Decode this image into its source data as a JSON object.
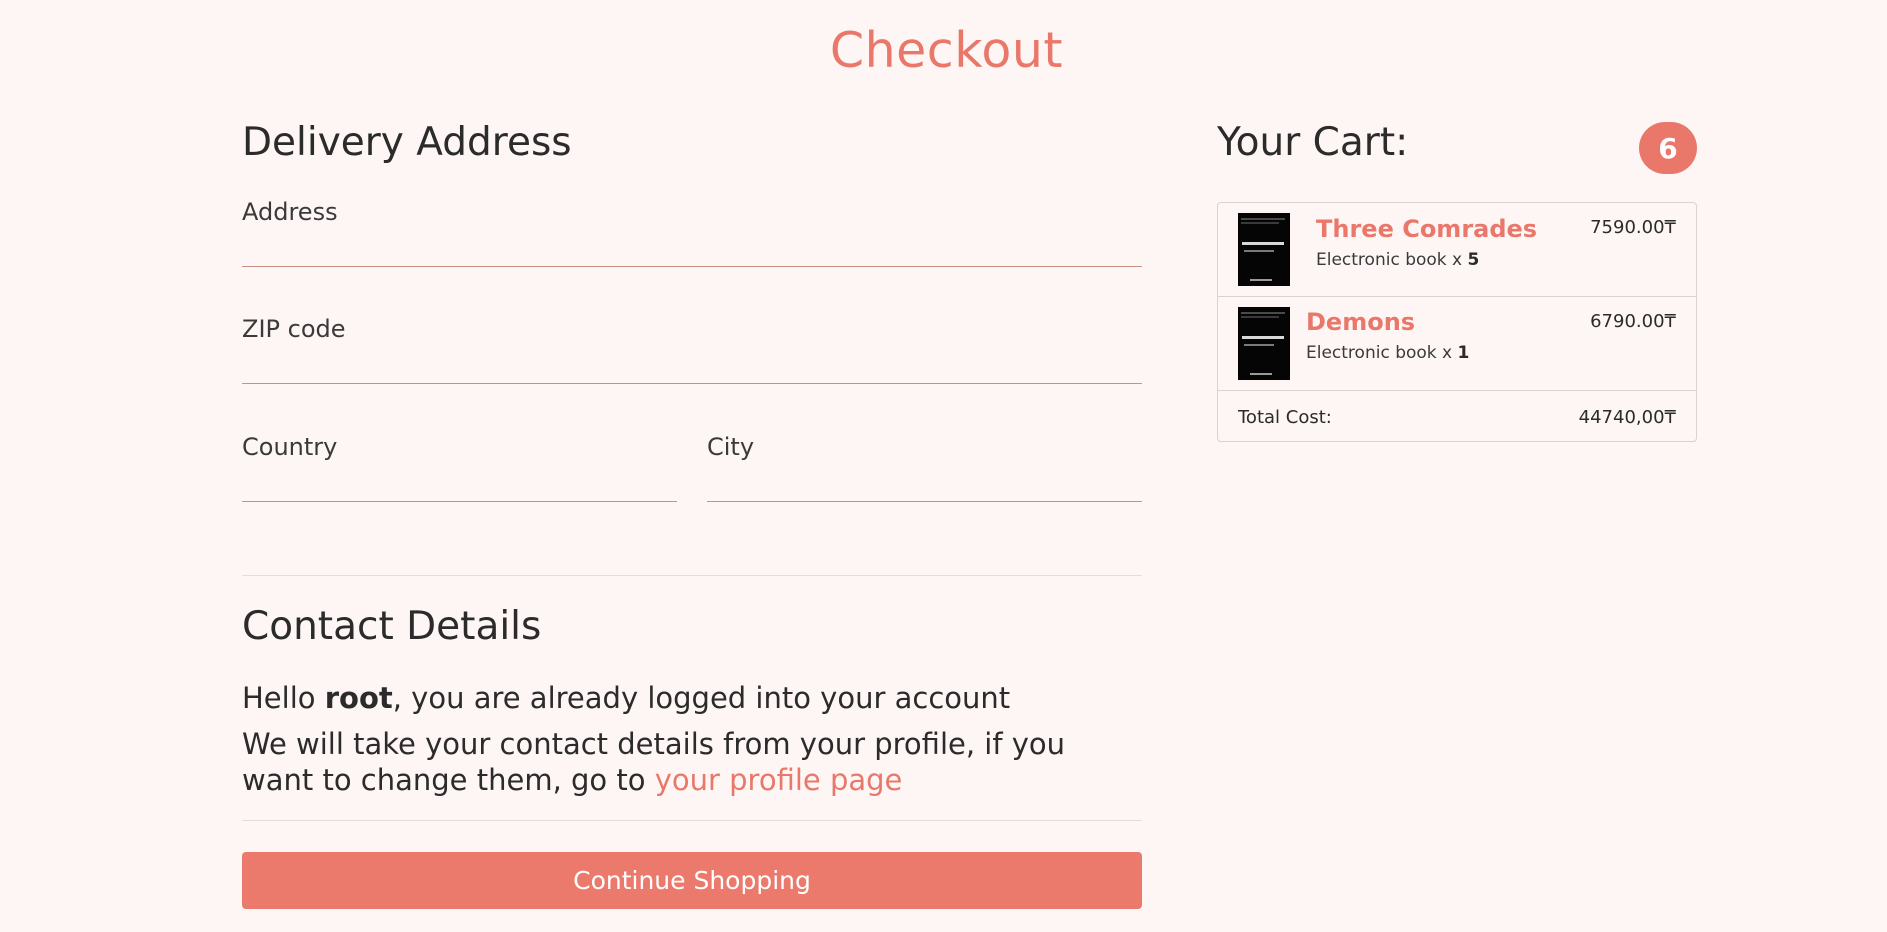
{
  "page_title": "Checkout",
  "delivery": {
    "title": "Delivery Address",
    "address_label": "Address",
    "address_value": "",
    "zip_label": "ZIP code",
    "zip_value": "",
    "country_label": "Country",
    "country_value": "",
    "city_label": "City",
    "city_value": ""
  },
  "contact": {
    "title": "Contact Details",
    "hello_prefix": "Hello ",
    "username": "root",
    "hello_suffix": ", you are already logged into your account",
    "info_text": "We will take your contact details from your profile, if you want to change them, go to ",
    "profile_link": "your profile page"
  },
  "continue_button": "Continue Shopping",
  "cart": {
    "title": "Your Cart:",
    "count": "6",
    "items": [
      {
        "name": "Three Comrades",
        "type": "Electronic book x ",
        "qty": "5",
        "price": "7590.00₸",
        "cover_icon": "book-cover-image"
      },
      {
        "name": "Demons",
        "type": "Electronic book x ",
        "qty": "1",
        "price": "6790.00₸",
        "cover_icon": "book-cover-image"
      }
    ],
    "total_label": "Total Cost:",
    "total_value": "44740,00₸"
  },
  "colors": {
    "accent": "#e9786b",
    "button": "#ec7a6c",
    "background": "#fdf6f5",
    "text": "#2b2b2b"
  }
}
